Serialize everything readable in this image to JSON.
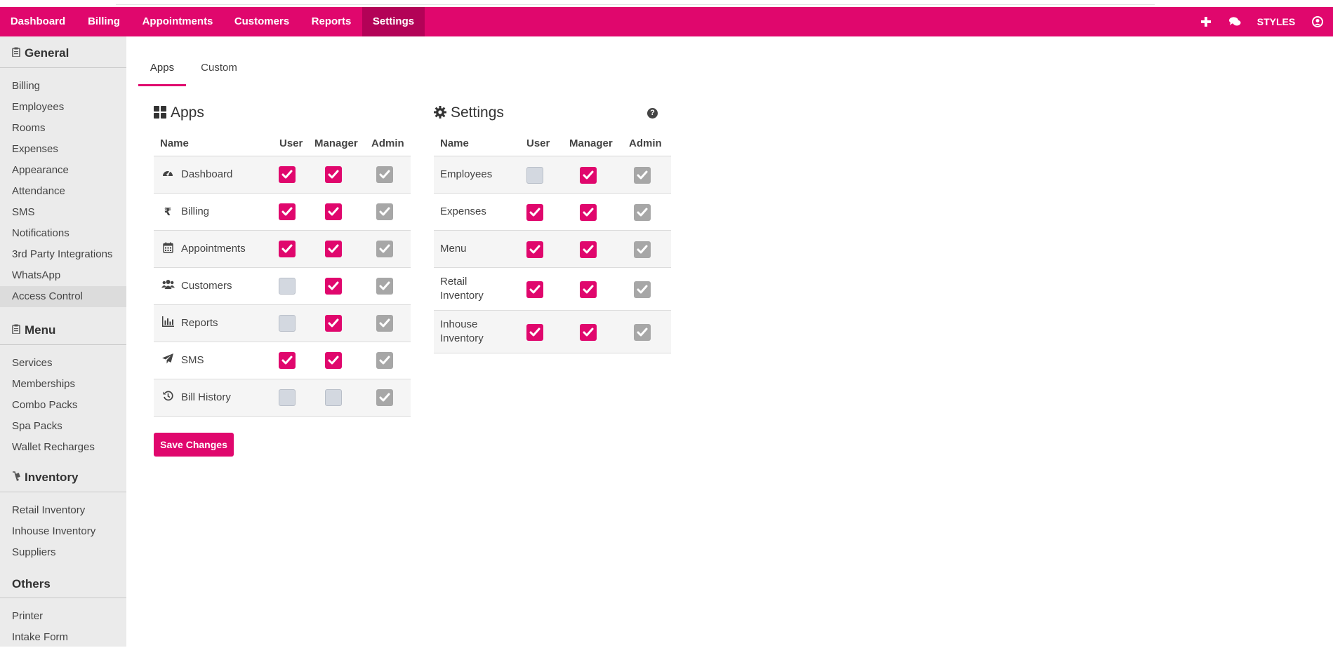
{
  "navbar": {
    "items": [
      "Dashboard",
      "Billing",
      "Appointments",
      "Customers",
      "Reports",
      "Settings"
    ],
    "active": "Settings",
    "styles_label": "STYLES",
    "icons": [
      "plus-icon",
      "chat-icon",
      "user-circle-icon"
    ]
  },
  "sidebar": {
    "sections": [
      {
        "title": "General",
        "icon": "clipboard-icon",
        "items": [
          "Billing",
          "Employees",
          "Rooms",
          "Expenses",
          "Appearance",
          "Attendance",
          "SMS",
          "Notifications",
          "3rd Party Integrations",
          "WhatsApp",
          "Access Control"
        ]
      },
      {
        "title": "Menu",
        "icon": "clipboard-icon",
        "items": [
          "Services",
          "Memberships",
          "Combo Packs",
          "Spa Packs",
          "Wallet Recharges"
        ]
      },
      {
        "title": "Inventory",
        "icon": "dolly-icon",
        "items": [
          "Retail Inventory",
          "Inhouse Inventory",
          "Suppliers"
        ]
      },
      {
        "title": "Others",
        "icon": "",
        "items": [
          "Printer",
          "Intake Form"
        ]
      }
    ],
    "active_item": "Access Control"
  },
  "tabs": {
    "items": [
      "Apps",
      "Custom"
    ],
    "active": "Apps"
  },
  "apps_panel": {
    "title": "Apps",
    "icon": "grid-icon",
    "headers": [
      "Name",
      "User",
      "Manager",
      "Admin"
    ],
    "rows": [
      {
        "name": "Dashboard",
        "icon": "dashboard-gauge-icon",
        "user": true,
        "manager": true,
        "admin": true
      },
      {
        "name": "Billing",
        "icon": "rupee-icon",
        "user": true,
        "manager": true,
        "admin": true
      },
      {
        "name": "Appointments",
        "icon": "calendar-icon",
        "user": true,
        "manager": true,
        "admin": true
      },
      {
        "name": "Customers",
        "icon": "users-icon",
        "user": false,
        "manager": true,
        "admin": true
      },
      {
        "name": "Reports",
        "icon": "bar-chart-icon",
        "user": false,
        "manager": true,
        "admin": true
      },
      {
        "name": "SMS",
        "icon": "paper-plane-icon",
        "user": true,
        "manager": true,
        "admin": true
      },
      {
        "name": "Bill History",
        "icon": "history-icon",
        "user": false,
        "manager": false,
        "admin": true
      }
    ]
  },
  "settings_panel": {
    "title": "Settings",
    "icon": "gear-icon",
    "help_glyph": "?",
    "headers": [
      "Name",
      "User",
      "Manager",
      "Admin"
    ],
    "rows": [
      {
        "name_lines": [
          "Employees"
        ],
        "user": false,
        "manager": true,
        "admin": true
      },
      {
        "name_lines": [
          "Expenses"
        ],
        "user": true,
        "manager": true,
        "admin": true
      },
      {
        "name_lines": [
          "Menu"
        ],
        "user": true,
        "manager": true,
        "admin": true
      },
      {
        "name_lines": [
          "Retail",
          "Inventory"
        ],
        "user": true,
        "manager": true,
        "admin": true
      },
      {
        "name_lines": [
          "Inhouse",
          "Inventory"
        ],
        "user": true,
        "manager": true,
        "admin": true
      }
    ]
  },
  "save_button": {
    "label": "Save Changes"
  },
  "colors": {
    "accent": "#e0076d",
    "accent_dark": "#b30257",
    "admin_locked": "#a7a7a7",
    "unchecked": "#d3d8e0"
  }
}
